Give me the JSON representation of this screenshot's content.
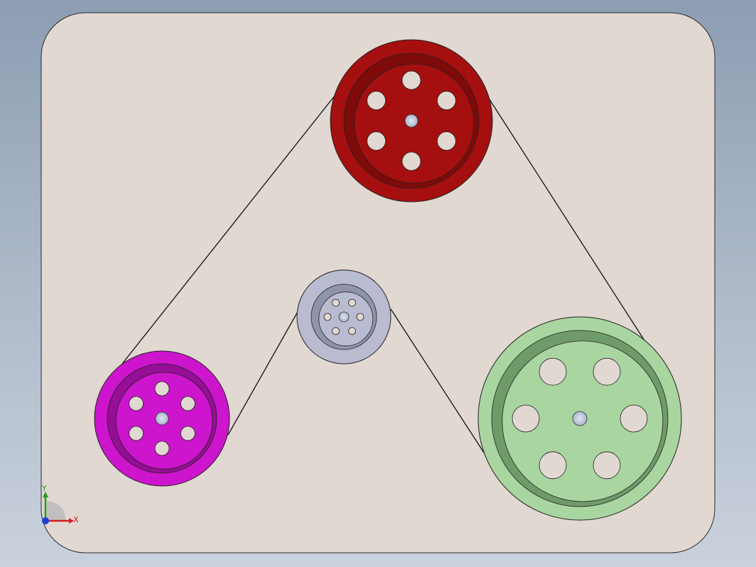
{
  "viewport": {
    "background_top": "#8d9db2",
    "background_bottom": "#c9d1dc"
  },
  "base_plate": {
    "color": "#e2d8d2"
  },
  "pulleys": [
    {
      "id": "top",
      "name": "pulley-red",
      "color": "#a50f0f",
      "rim_dark": "#7e0a0a",
      "holes": 6
    },
    {
      "id": "left",
      "name": "pulley-magenta",
      "color": "#cc15cc",
      "rim_dark": "#950e95",
      "holes": 6
    },
    {
      "id": "center",
      "name": "pulley-gray",
      "color": "#b9bcd0",
      "rim_dark": "#8f93ab",
      "holes": 6
    },
    {
      "id": "right",
      "name": "pulley-green",
      "color": "#a9d5a1",
      "rim_dark": "#6f9a69",
      "holes": 6
    }
  ],
  "belt": {
    "color": "#111111"
  },
  "triad": {
    "x_label": "X",
    "y_label": "Y",
    "x_color": "#d41f1f",
    "y_color": "#1f9d1f",
    "z_color": "#1f3fd4"
  }
}
